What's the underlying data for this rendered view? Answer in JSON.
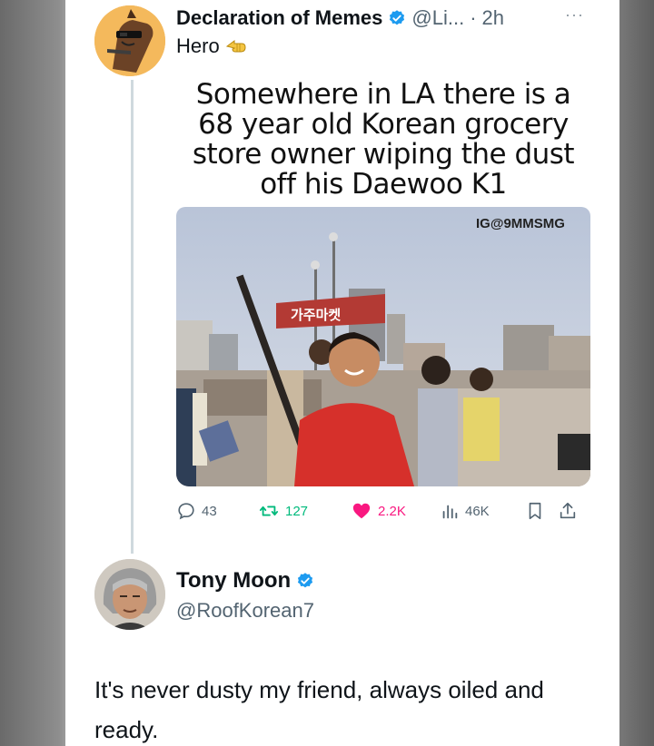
{
  "tweet": {
    "display_name": "Declaration of Memes",
    "handle": "@Li...",
    "separator": "·",
    "time": "2h",
    "more": "···",
    "text": "Hero",
    "emoji_icon": "pointing-hand-icon",
    "meme": {
      "caption": "Somewhere in LA there is a 68 year old Korean grocery store owner wiping the dust off his Daewoo K1",
      "watermark": "IG@9MMSMG",
      "banner_text": "가주마켓"
    },
    "actions": {
      "replies": "43",
      "retweets": "127",
      "likes": "2.2K",
      "views": "46K"
    }
  },
  "reply": {
    "display_name": "Tony Moon",
    "handle": "@RoofKorean7",
    "text": "It's never dusty my friend, always oiled and ready."
  },
  "colors": {
    "verified": "#1d9bf0",
    "retweet": "#00ba7c",
    "like": "#f91880",
    "text": "#0f1419",
    "muted": "#536471"
  }
}
